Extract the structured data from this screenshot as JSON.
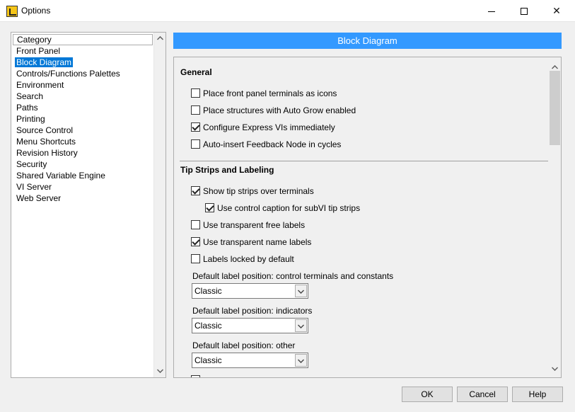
{
  "window": {
    "title": "Options",
    "minimize": "—",
    "maximize": "☐",
    "close": "✕"
  },
  "category": {
    "header": "Category",
    "items": [
      {
        "label": "Front Panel",
        "selected": false
      },
      {
        "label": "Block Diagram",
        "selected": true
      },
      {
        "label": "Controls/Functions Palettes",
        "selected": false
      },
      {
        "label": "Environment",
        "selected": false
      },
      {
        "label": "Search",
        "selected": false
      },
      {
        "label": "Paths",
        "selected": false
      },
      {
        "label": "Printing",
        "selected": false
      },
      {
        "label": "Source Control",
        "selected": false
      },
      {
        "label": "Menu Shortcuts",
        "selected": false
      },
      {
        "label": "Revision History",
        "selected": false
      },
      {
        "label": "Security",
        "selected": false
      },
      {
        "label": "Shared Variable Engine",
        "selected": false
      },
      {
        "label": "VI Server",
        "selected": false
      },
      {
        "label": "Web Server",
        "selected": false
      }
    ]
  },
  "section_title": "Block Diagram",
  "general": {
    "title": "General",
    "options": [
      {
        "label": "Place front panel terminals as icons",
        "checked": false
      },
      {
        "label": "Place structures with Auto Grow enabled",
        "checked": false
      },
      {
        "label": "Configure Express VIs immediately",
        "checked": true
      },
      {
        "label": "Auto-insert Feedback Node in cycles",
        "checked": false
      }
    ]
  },
  "tipstrips": {
    "title": "Tip Strips and Labeling",
    "options": [
      {
        "label": "Show tip strips over terminals",
        "checked": true
      },
      {
        "label": "Use control caption for subVI tip strips",
        "checked": true
      },
      {
        "label": "Use transparent free labels",
        "checked": false
      },
      {
        "label": "Use transparent name labels",
        "checked": true
      },
      {
        "label": "Labels locked by default",
        "checked": false
      }
    ],
    "label_positions": [
      {
        "label": "Default label position: control terminals and constants",
        "value": "Classic"
      },
      {
        "label": "Default label position: indicators",
        "value": "Classic"
      },
      {
        "label": "Default label position: other",
        "value": "Classic"
      }
    ]
  },
  "buttons": {
    "ok": "OK",
    "cancel": "Cancel",
    "help": "Help"
  },
  "colors": {
    "accent": "#3399ff",
    "selection": "#0078d7"
  }
}
